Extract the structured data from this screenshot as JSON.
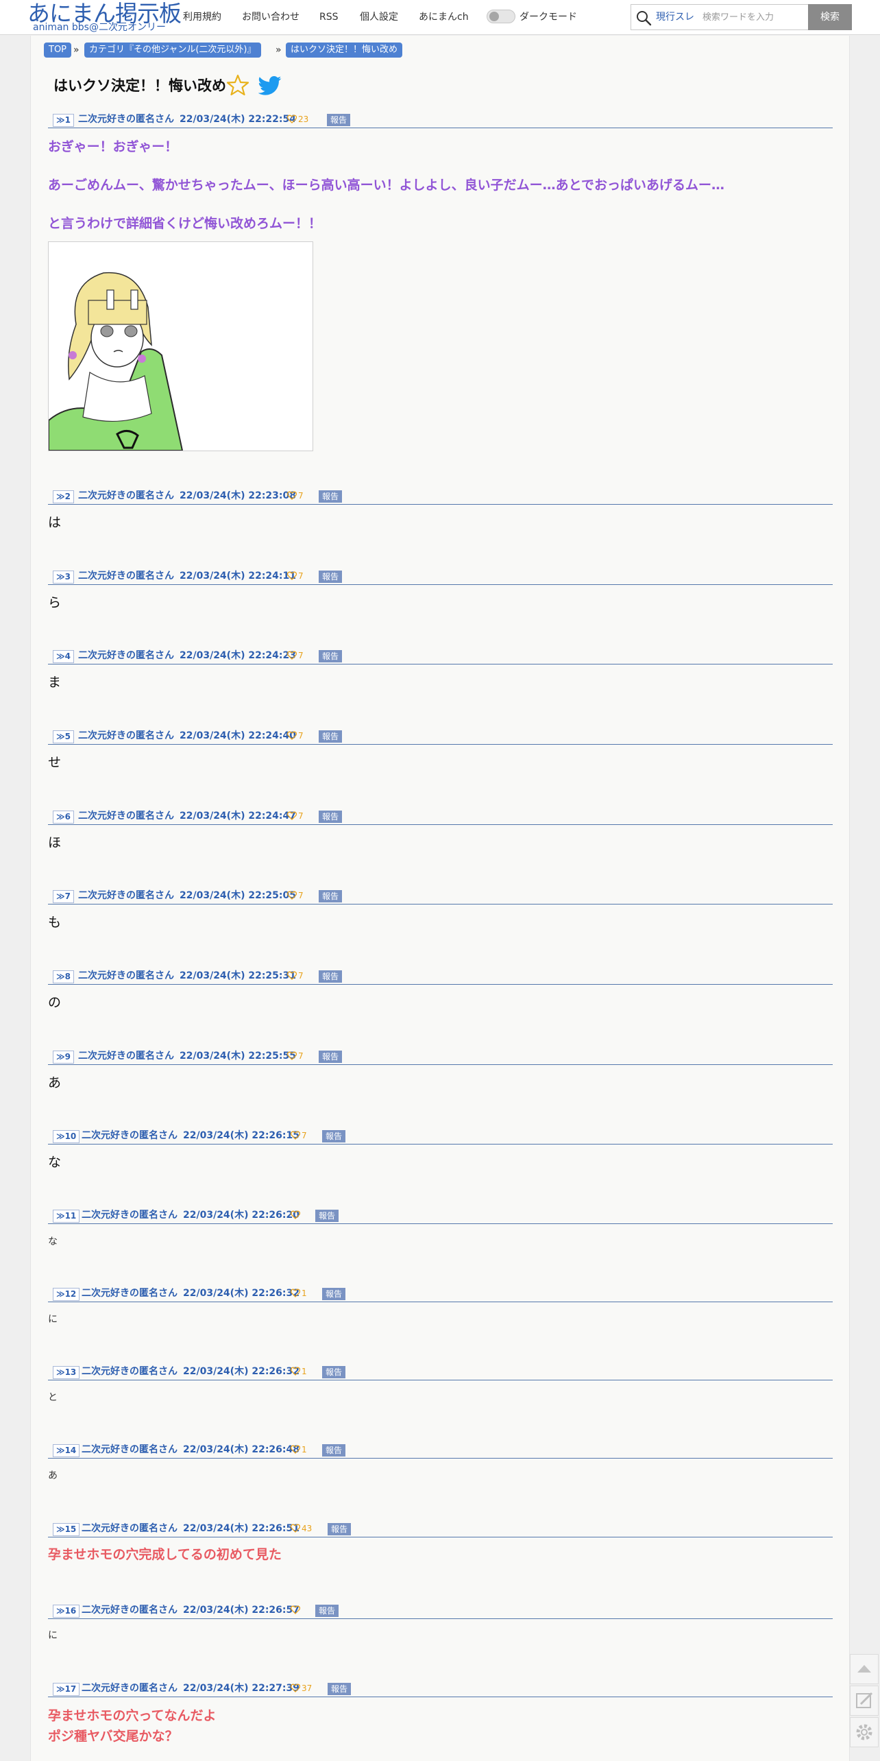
{
  "header": {
    "logo_title": "あにまん掲示板",
    "logo_sub": "animan bbs@二次元オンリー",
    "nav": [
      "利用規約",
      "お問い合わせ",
      "RSS",
      "個人設定",
      "あにまんch"
    ],
    "dark_mode_label": "ダークモード",
    "search_scope": "現行スレ",
    "search_placeholder": "検索ワードを入力",
    "search_button": "検索"
  },
  "breadcrumb": [
    "TOP",
    "カテゴリ『その他ジャンル(二次元以外)』",
    "はいクソ決定！！悔い改め"
  ],
  "breadcrumb_sep": "»",
  "thread_title": "はいクソ決定！！悔い改め",
  "report_label": "報告",
  "posts": [
    {
      "num": "≫1",
      "author": "二次元好きの匿名さん",
      "date": "22/03/24(木) 22:22:54",
      "likes": "23",
      "lines": [
        "おぎゃー！おぎゃー！",
        "あーごめんムー、驚かせちゃったムー、ほーら高い高ーい！よしよし、良い子だムー…あとでおっぱいあげるムー…",
        "と言うわけで詳細省くけど悔い改めろムー！！"
      ]
    },
    {
      "num": "≫2",
      "author": "二次元好きの匿名さん",
      "date": "22/03/24(木) 22:23:08",
      "likes": "7",
      "lines": [
        "は"
      ]
    },
    {
      "num": "≫3",
      "author": "二次元好きの匿名さん",
      "date": "22/03/24(木) 22:24:11",
      "likes": "7",
      "lines": [
        "ら"
      ]
    },
    {
      "num": "≫4",
      "author": "二次元好きの匿名さん",
      "date": "22/03/24(木) 22:24:23",
      "likes": "7",
      "lines": [
        "ま"
      ]
    },
    {
      "num": "≫5",
      "author": "二次元好きの匿名さん",
      "date": "22/03/24(木) 22:24:40",
      "likes": "7",
      "lines": [
        "せ"
      ]
    },
    {
      "num": "≫6",
      "author": "二次元好きの匿名さん",
      "date": "22/03/24(木) 22:24:47",
      "likes": "7",
      "lines": [
        "ほ"
      ]
    },
    {
      "num": "≫7",
      "author": "二次元好きの匿名さん",
      "date": "22/03/24(木) 22:25:05",
      "likes": "7",
      "lines": [
        "も"
      ]
    },
    {
      "num": "≫8",
      "author": "二次元好きの匿名さん",
      "date": "22/03/24(木) 22:25:31",
      "likes": "7",
      "lines": [
        "の"
      ]
    },
    {
      "num": "≫9",
      "author": "二次元好きの匿名さん",
      "date": "22/03/24(木) 22:25:55",
      "likes": "7",
      "lines": [
        "あ"
      ]
    },
    {
      "num": "≫10",
      "author": "二次元好きの匿名さん",
      "date": "22/03/24(木) 22:26:15",
      "likes": "7",
      "lines": [
        "な"
      ]
    },
    {
      "num": "≫11",
      "author": "二次元好きの匿名さん",
      "date": "22/03/24(木) 22:26:20",
      "likes": "",
      "lines": [
        "な"
      ]
    },
    {
      "num": "≫12",
      "author": "二次元好きの匿名さん",
      "date": "22/03/24(木) 22:26:32",
      "likes": "1",
      "lines": [
        "に"
      ]
    },
    {
      "num": "≫13",
      "author": "二次元好きの匿名さん",
      "date": "22/03/24(木) 22:26:32",
      "likes": "1",
      "lines": [
        "と"
      ]
    },
    {
      "num": "≫14",
      "author": "二次元好きの匿名さん",
      "date": "22/03/24(木) 22:26:48",
      "likes": "1",
      "lines": [
        "あ"
      ]
    },
    {
      "num": "≫15",
      "author": "二次元好きの匿名さん",
      "date": "22/03/24(木) 22:26:51",
      "likes": "43",
      "lines": [
        "孕ませホモの穴完成してるの初めて見た"
      ]
    },
    {
      "num": "≫16",
      "author": "二次元好きの匿名さん",
      "date": "22/03/24(木) 22:26:57",
      "likes": "",
      "lines": [
        "に"
      ]
    },
    {
      "num": "≫17",
      "author": "二次元好きの匿名さん",
      "date": "22/03/24(木) 22:27:39",
      "likes": "37",
      "lines": [
        "孕ませホモの穴ってなんだよ",
        "ポジ種ヤバ交尾かな？"
      ]
    }
  ],
  "colors": {
    "accent": "#2e5fb0",
    "crumb": "#4e81d2",
    "purple_text": "#9155d6",
    "red_text": "#e85a62",
    "like": "#e8a21c",
    "report": "#7a93c3"
  },
  "icons": [
    "search-icon",
    "star-icon",
    "twitter-icon",
    "heart-icon",
    "scroll-top-icon",
    "edit-icon",
    "settings-icon"
  ]
}
